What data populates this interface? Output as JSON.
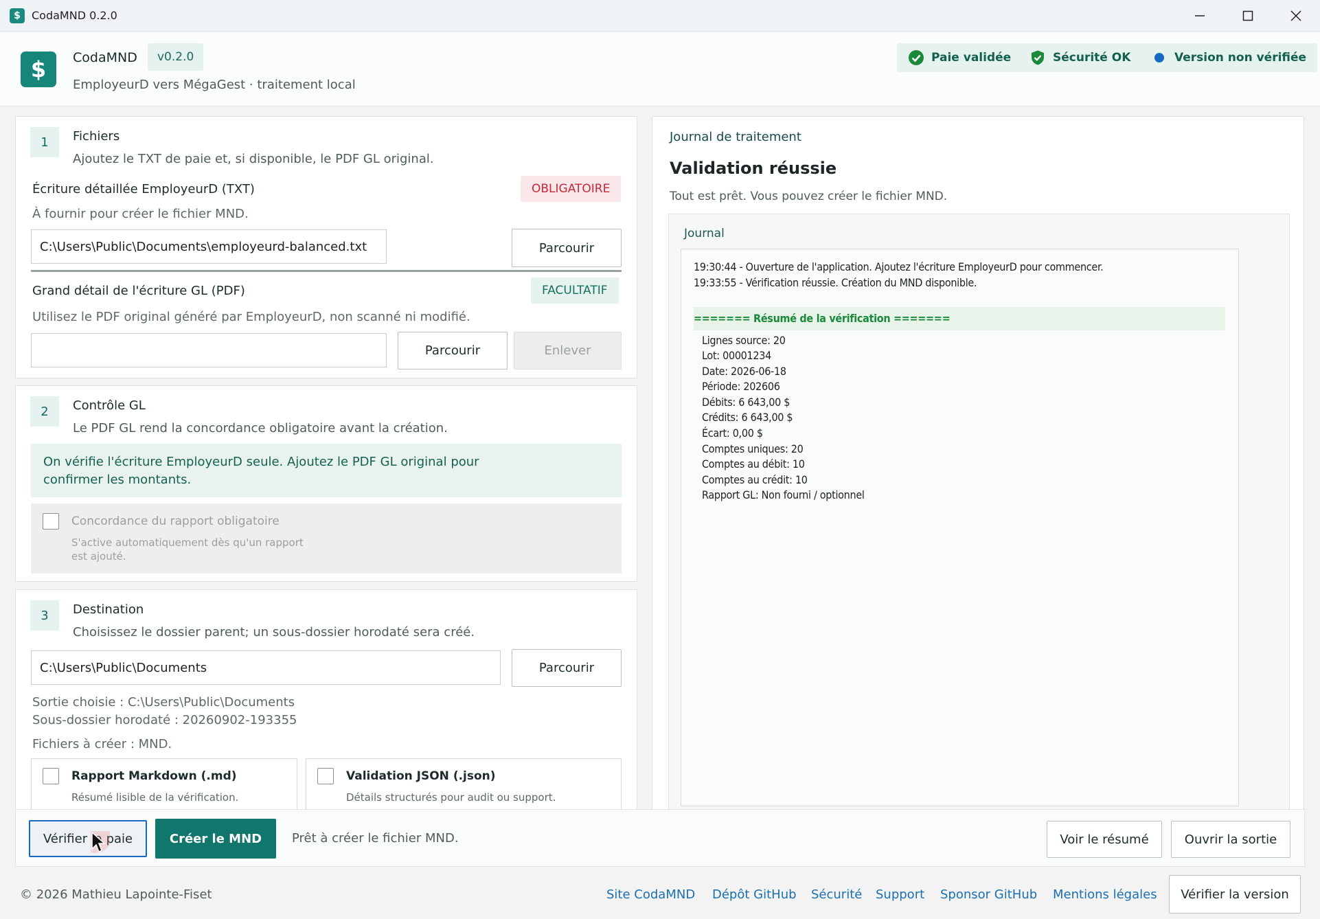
{
  "window": {
    "title": "CodaMND 0.2.0",
    "icon": "$"
  },
  "header": {
    "logo": "$",
    "app_name": "CodaMND",
    "version": "v0.2.0",
    "subtitle": "EmployeurD vers MégaGest · traitement local",
    "statuses": [
      {
        "label": "Paie validée",
        "icon": "check-circle-icon"
      },
      {
        "label": "Sécurité OK",
        "icon": "shield-check-icon"
      },
      {
        "label": "Version non vérifiée",
        "icon": "dot-icon"
      }
    ]
  },
  "step1": {
    "num": "1",
    "title": "Fichiers",
    "subtitle": "Ajoutez le TXT de paie et, si disponible, le PDF GL original.",
    "txt": {
      "label": "Écriture détaillée EmployeurD (TXT)",
      "badge": "OBLIGATOIRE",
      "hint": "À fournir pour créer le fichier MND.",
      "value": "C:\\Users\\Public\\Documents\\employeurd-balanced.txt",
      "browse": "Parcourir"
    },
    "pdf": {
      "label": "Grand détail de l'écriture GL (PDF)",
      "badge": "FACULTATIF",
      "hint": "Utilisez le PDF original généré par EmployeurD, non scanné ni modifié.",
      "value": "",
      "browse": "Parcourir",
      "remove": "Enlever"
    }
  },
  "step2": {
    "num": "2",
    "title": "Contrôle GL",
    "subtitle": "Le PDF GL rend la concordance obligatoire avant la création.",
    "note_line1": "On vérifie l'écriture EmployeurD seule. Ajoutez le PDF GL original pour",
    "note_line2": "confirmer les montants.",
    "checkbox_label": "Concordance du rapport obligatoire",
    "checkbox_hint1": "S'active automatiquement dès qu'un rapport",
    "checkbox_hint2": "est ajouté."
  },
  "step3": {
    "num": "3",
    "title": "Destination",
    "subtitle": "Choisissez le dossier parent; un sous-dossier horodaté sera créé.",
    "value": "C:\\Users\\Public\\Documents",
    "browse": "Parcourir",
    "output_chosen": "Sortie choisie : C:\\Users\\Public\\Documents",
    "subfolder": "Sous-dossier horodaté : 20260902-193355",
    "files_to_create": "Fichiers à créer : MND.",
    "options": [
      {
        "label": "Rapport Markdown (.md)",
        "hint": "Résumé lisible de la vérification."
      },
      {
        "label": "Validation JSON (.json)",
        "hint": "Détails structurés pour audit ou support."
      }
    ]
  },
  "journal": {
    "heading": "Journal de traitement",
    "title": "Validation réussie",
    "subtitle": "Tout est prêt. Vous pouvez créer le fichier MND.",
    "log_label": "Journal",
    "lines": [
      "19:30:44 - Ouverture de l'application. Ajoutez l'écriture EmployeurD pour commencer.",
      "19:33:55 - Vérification réussie. Création du MND disponible."
    ],
    "summary_header": "======= Résumé de la vérification =======",
    "summary": [
      "Lignes source: 20",
      "Lot: 00001234",
      "Date: 2026-06-18",
      "Période: 202606",
      "Débits: 6 643,00 $",
      "Crédits: 6 643,00 $",
      "Écart: 0,00 $",
      "Comptes uniques: 20",
      "Comptes au débit: 10",
      "Comptes au crédit: 10",
      "Rapport GL: Non fourni / optionnel"
    ]
  },
  "actions": {
    "verify": "Vérifier la paie",
    "create": "Créer le MND",
    "status": "Prêt à créer le fichier MND.",
    "view_summary": "Voir le résumé",
    "open_output": "Ouvrir la sortie"
  },
  "footer": {
    "copyright": "© 2026 Mathieu Lapointe-Fiset",
    "links": [
      "Site CodaMND",
      "Dépôt GitHub",
      "Sécurité",
      "Support",
      "Sponsor GitHub",
      "Mentions légales"
    ],
    "check_version": "Vérifier la version"
  },
  "colors": {
    "accent": "#11766c",
    "required": "#c8273a",
    "link": "#1a6fb0"
  }
}
